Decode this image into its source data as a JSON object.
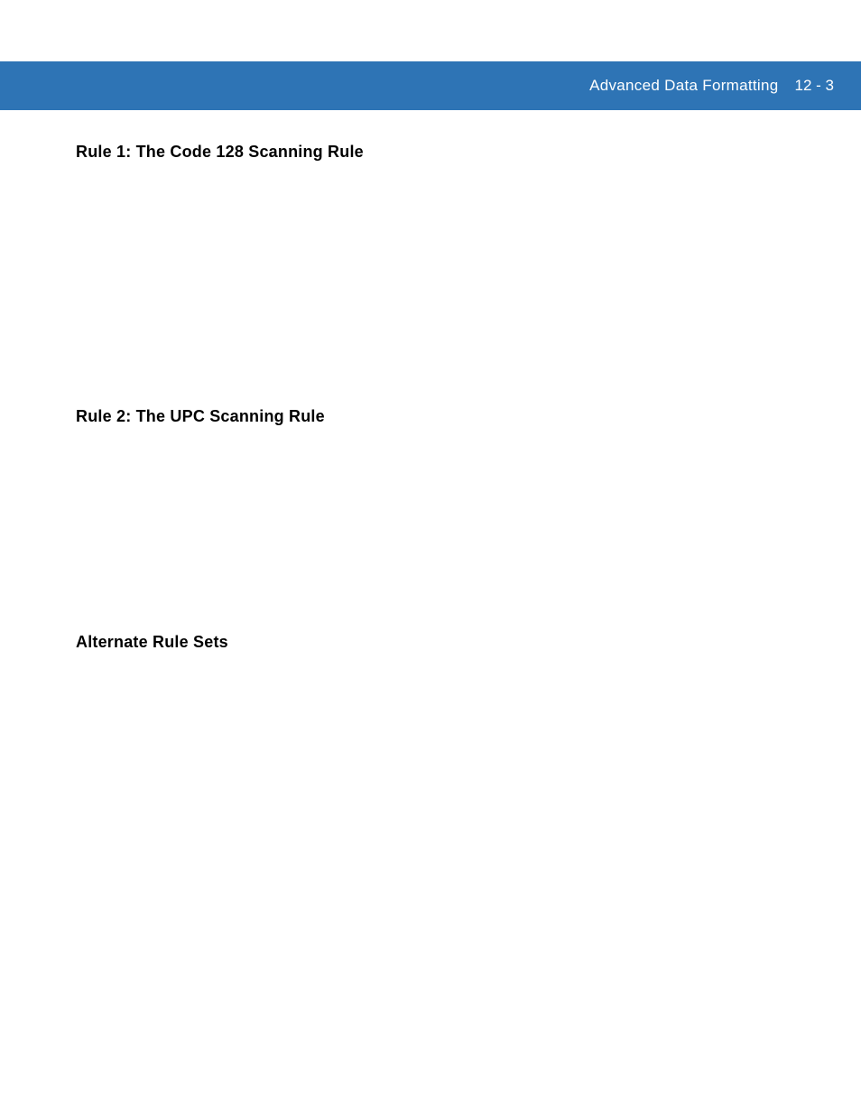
{
  "header": {
    "title": "Advanced Data Formatting",
    "page_number": "12 - 3"
  },
  "sections": {
    "rule1": {
      "heading": "Rule 1: The Code 128 Scanning Rule"
    },
    "rule2": {
      "heading": "Rule 2: The UPC Scanning Rule"
    },
    "alt_sets": {
      "heading": "Alternate Rule Sets"
    }
  }
}
